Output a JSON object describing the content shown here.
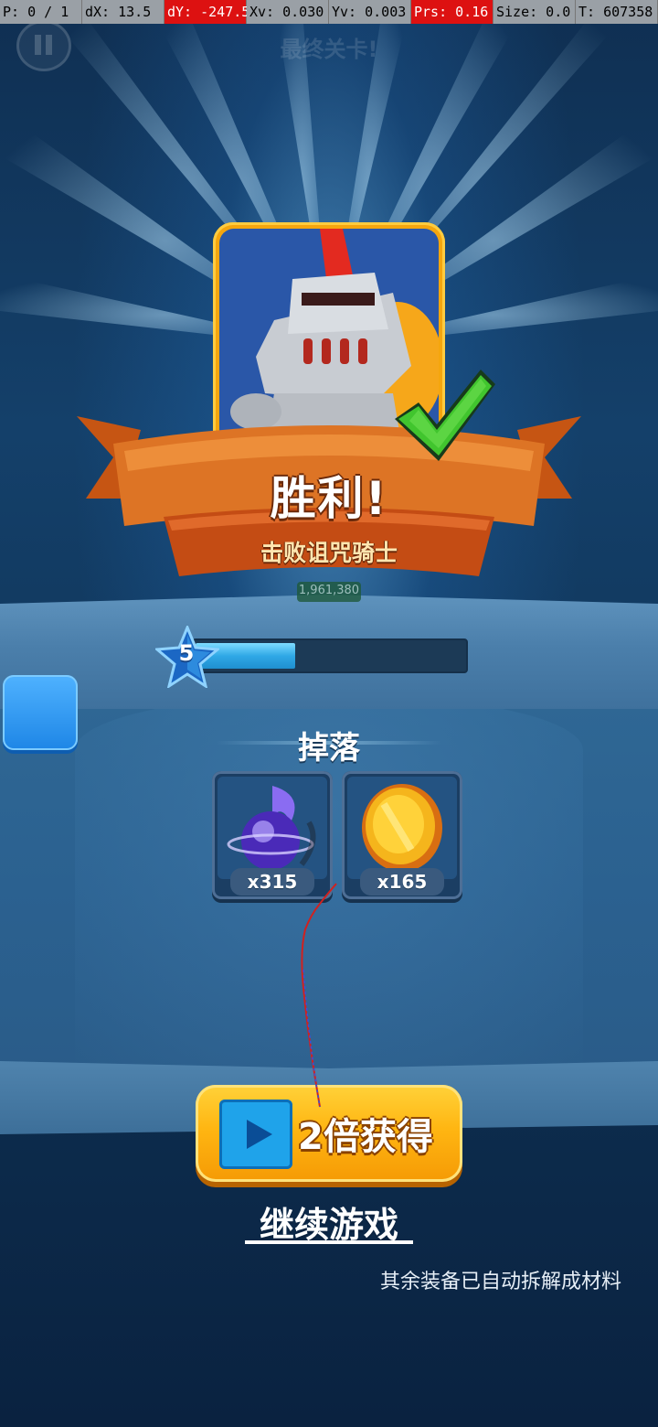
{
  "debug": {
    "p": "P: 0 / 1",
    "dx": "dX: 13.5",
    "dy": "dY: -247.5",
    "xv": "Xv: 0.030",
    "yv": "Yv: 0.003",
    "prs": "Prs: 0.16",
    "size": "Size: 0.0",
    "t": "T: 607358"
  },
  "header": {
    "level_title": "最终关卡!"
  },
  "result": {
    "title": "胜利!",
    "subtitle": "击败诅咒骑士",
    "score": "1,961,380"
  },
  "level": {
    "number": "5",
    "progress_fraction": 0.37
  },
  "drops": {
    "title": "掉落",
    "items": [
      {
        "name": "soul-orb",
        "qty": "x315"
      },
      {
        "name": "gold-coin",
        "qty": "x165"
      }
    ]
  },
  "actions": {
    "double_label": "2倍获得",
    "continue_label": "继续游戏"
  },
  "footer": {
    "note": "其余装备已自动拆解成材料"
  },
  "colors": {
    "accent_orange": "#f5a60e",
    "xp_blue": "#2fa8e6",
    "ribbon": "#d8661c",
    "check_green": "#3fc22b"
  }
}
